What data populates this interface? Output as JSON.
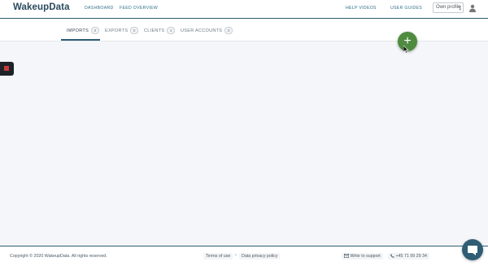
{
  "app": {
    "logo": "WakeupData"
  },
  "nav": {
    "dashboard": "DASHBOARD",
    "feed_overview": "FEED OVERVIEW",
    "help_videos": "HELP VIDEOS",
    "user_guides": "USER GUIDES"
  },
  "profile_select": {
    "value": "Own profile"
  },
  "tabs": [
    {
      "label": "IMPORTS",
      "count": "0"
    },
    {
      "label": "EXPORTS",
      "count": "0"
    },
    {
      "label": "CLIENTS",
      "count": "1"
    },
    {
      "label": "USER ACCOUNTS",
      "count": "0"
    }
  ],
  "add_button": {
    "symbol": "+"
  },
  "footer": {
    "copyright": "Copyright © 2020 WakeupData. All rights reserved.",
    "terms": "Terms of use",
    "separator": "•",
    "privacy": "Data privacy policy",
    "support": "Write to support",
    "phone": "+45 71 99 29 34"
  },
  "colors": {
    "primary": "#2f5d73",
    "add_button": "#4e8b3f",
    "background": "#f5f6f9"
  },
  "icons": {
    "user": "user-icon",
    "chat": "chat-icon",
    "mail": "mail-icon",
    "phone": "phone-icon"
  }
}
